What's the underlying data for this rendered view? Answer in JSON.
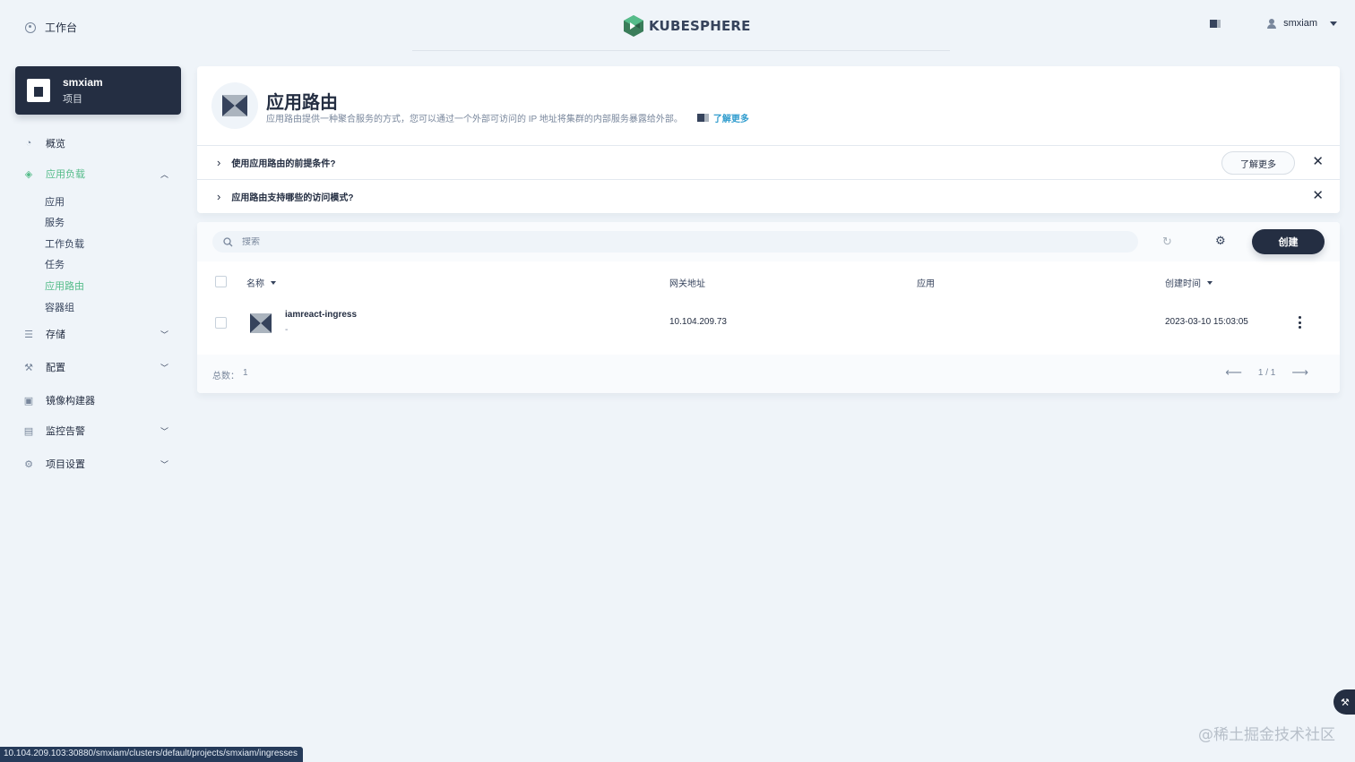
{
  "header": {
    "workbench_label": "工作台",
    "logo_text": "KUBESPHERE",
    "username": "smxiam",
    "brand_color": "#55bc8a"
  },
  "project": {
    "name": "smxiam",
    "type": "项目"
  },
  "sidebar": {
    "items": [
      {
        "label": "概览",
        "icon": "dashboard-icon"
      },
      {
        "label": "应用负载",
        "icon": "layers-icon",
        "expanded": true
      },
      {
        "label": "存储",
        "icon": "database-icon"
      },
      {
        "label": "配置",
        "icon": "hammer-icon"
      },
      {
        "label": "镜像构建器",
        "icon": "image-builder-icon"
      },
      {
        "label": "监控告警",
        "icon": "monitor-icon"
      },
      {
        "label": "项目设置",
        "icon": "gear-icon"
      }
    ],
    "sub_items": [
      "应用",
      "服务",
      "工作负载",
      "任务",
      "应用路由",
      "容器组"
    ],
    "active_sub": "应用路由"
  },
  "banner": {
    "title": "应用路由",
    "description": "应用路由提供一种聚合服务的方式，您可以通过一个外部可访问的 IP 地址将集群的内部服务暴露给外部。",
    "learn_more": "了解更多",
    "faqs": [
      {
        "question": "使用应用路由的前提条件?",
        "button": "了解更多"
      },
      {
        "question": "应用路由支持哪些的访问模式?"
      }
    ]
  },
  "toolbar": {
    "search_placeholder": "搜索",
    "create_label": "创建"
  },
  "table": {
    "columns": {
      "name": "名称",
      "gateway": "网关地址",
      "app": "应用",
      "created": "创建时间"
    },
    "rows": [
      {
        "name": "iamreact-ingress",
        "description": "-",
        "gateway": "10.104.209.73",
        "app": "",
        "created": "2023-03-10 15:03:05"
      }
    ],
    "total_label": "总数：",
    "total_count": "1",
    "page": "1 / 1"
  },
  "status_url": "10.104.209.103:30880/smxiam/clusters/default/projects/smxiam/ingresses",
  "watermark": "@稀土掘金技术社区"
}
